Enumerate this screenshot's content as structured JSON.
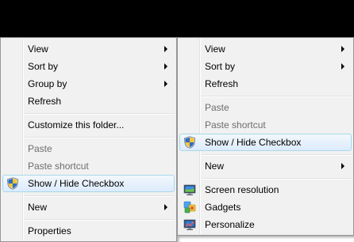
{
  "left_menu": {
    "items": [
      {
        "label": "View"
      },
      {
        "label": "Sort by"
      },
      {
        "label": "Group by"
      },
      {
        "label": "Refresh"
      },
      {
        "label": "Customize this folder..."
      },
      {
        "label": "Paste"
      },
      {
        "label": "Paste shortcut"
      },
      {
        "label": "Show / Hide Checkbox",
        "icon": "shield-icon"
      },
      {
        "label": "New"
      },
      {
        "label": "Properties"
      }
    ]
  },
  "right_menu": {
    "items": [
      {
        "label": "View"
      },
      {
        "label": "Sort by"
      },
      {
        "label": "Refresh"
      },
      {
        "label": "Paste"
      },
      {
        "label": "Paste shortcut"
      },
      {
        "label": "Show / Hide Checkbox",
        "icon": "shield-icon"
      },
      {
        "label": "New"
      },
      {
        "label": "Screen resolution",
        "icon": "monitor-icon"
      },
      {
        "label": "Gadgets",
        "icon": "gadgets-icon"
      },
      {
        "label": "Personalize",
        "icon": "personalize-icon"
      }
    ]
  },
  "colors": {
    "menu_background": "#f1f1f1",
    "highlight_border": "#a8d8eb",
    "disabled_text": "#6d6d6d"
  }
}
